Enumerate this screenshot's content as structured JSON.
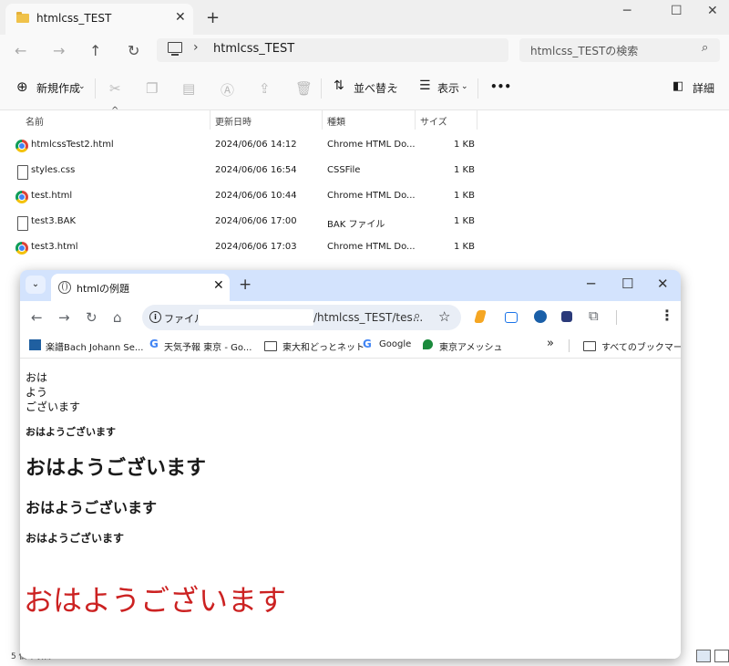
{
  "explorer": {
    "tab_title": "htmlcss_TEST",
    "breadcrumb": "htmlcss_TEST",
    "search_placeholder": "htmlcss_TESTの検索",
    "toolbar": {
      "new_label": "新規作成",
      "sort_label": "並べ替え",
      "view_label": "表示",
      "more_label": "•••",
      "details_label": "詳細"
    },
    "columns": [
      "名前",
      "更新日時",
      "種類",
      "サイズ"
    ],
    "files": [
      {
        "name": "htmlcssTest2.html",
        "date": "2024/06/06 14:12",
        "type": "Chrome HTML Do...",
        "size": "1 KB",
        "icon": "chrome-icon"
      },
      {
        "name": "styles.css",
        "date": "2024/06/06 16:54",
        "type": "CSSFile",
        "size": "1 KB",
        "icon": "file-icon"
      },
      {
        "name": "test.html",
        "date": "2024/06/06 10:44",
        "type": "Chrome HTML Do...",
        "size": "1 KB",
        "icon": "chrome-icon"
      },
      {
        "name": "test3.BAK",
        "date": "2024/06/06 17:00",
        "type": "BAK ファイル",
        "size": "1 KB",
        "icon": "file-icon"
      },
      {
        "name": "test3.html",
        "date": "2024/06/06 17:03",
        "type": "Chrome HTML Do...",
        "size": "1 KB",
        "icon": "chrome-icon"
      }
    ],
    "status": "5 個の項目"
  },
  "chrome": {
    "tab_title": "htmlの例題",
    "scheme_label": "ファイル",
    "url_visible": "/htmlcss_TEST/tes...",
    "bookmarks": [
      "楽譜Bach Johann Se...",
      "天気予報 東京 - Go...",
      "東大和どっとネット",
      "Google",
      "東京アメッシュ"
    ],
    "all_bookmarks": "すべてのブックマーク",
    "content": {
      "br_lines": [
        "おは",
        "よう",
        "ございます"
      ],
      "h6": "おはようございます",
      "h1": "おはようございます",
      "h3": "おはようございます",
      "h5": "おはようございます",
      "red_large": "おはようございます"
    },
    "accent_color": "#d3e3fd",
    "red_text_color": "#cc2222"
  }
}
